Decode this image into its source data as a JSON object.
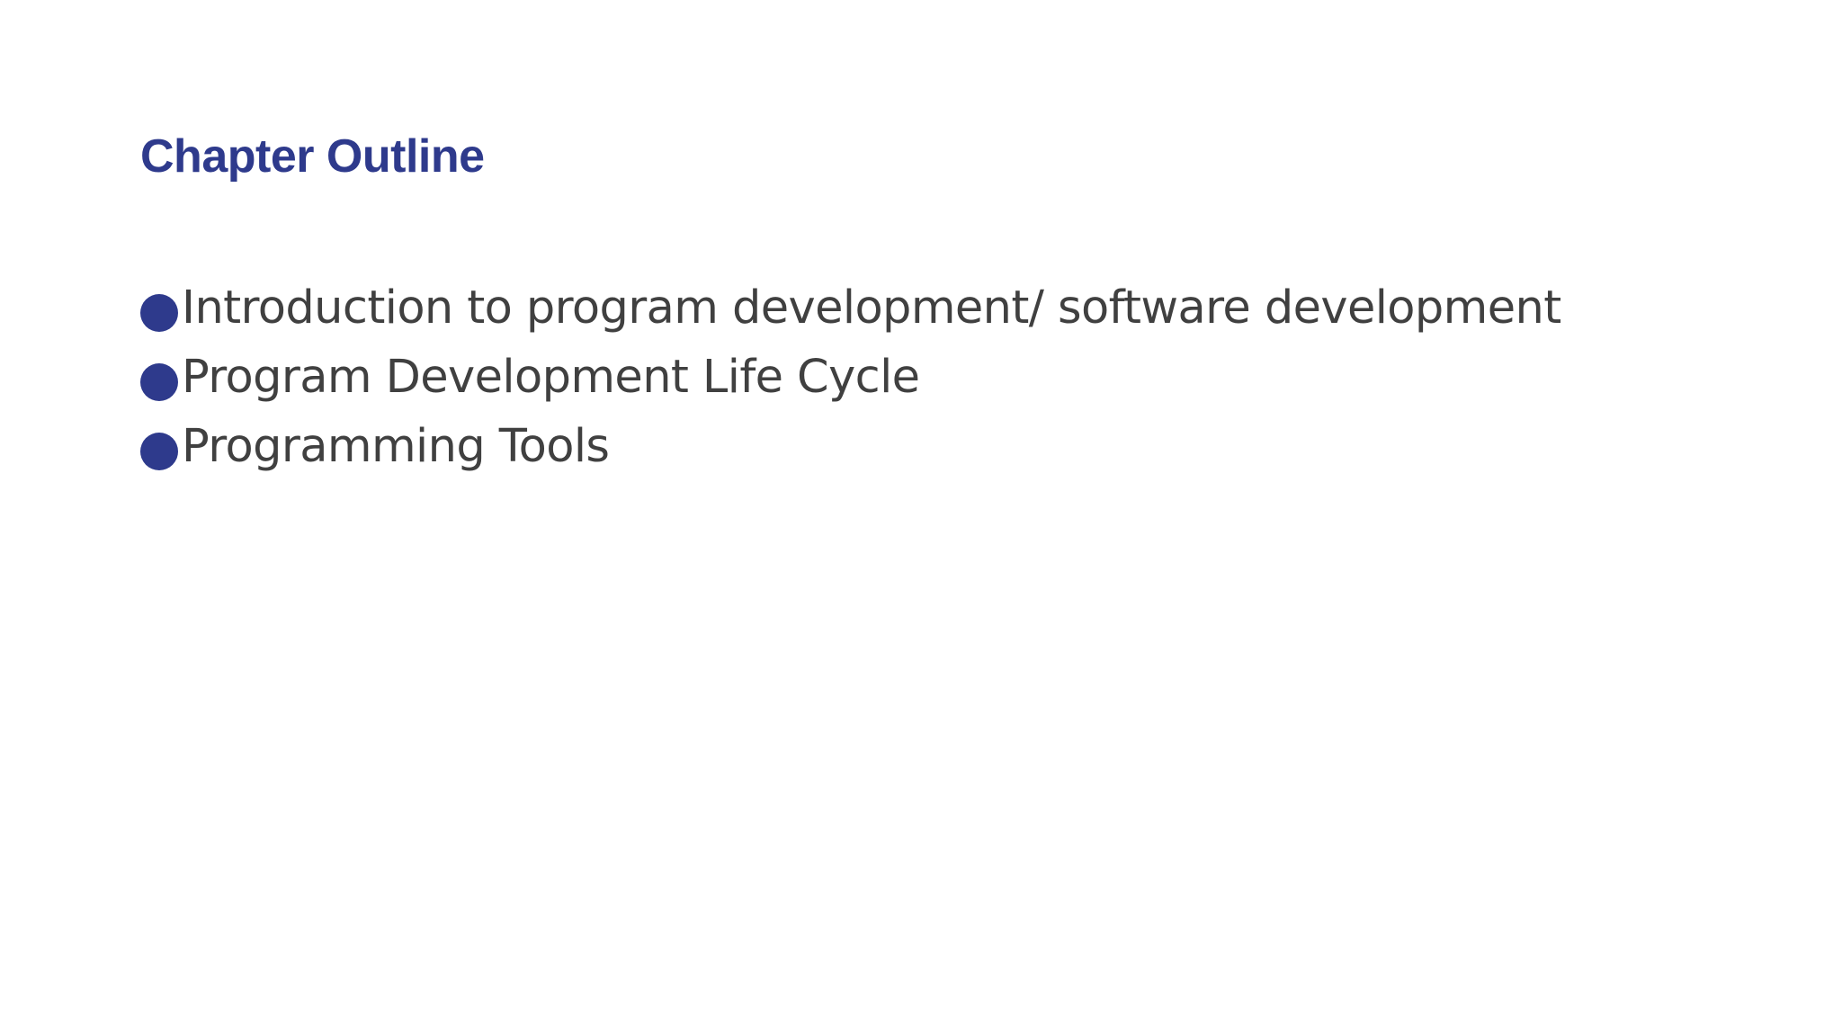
{
  "slide": {
    "title": "Chapter Outline",
    "bullets": [
      {
        "text": "Introduction to program development/ software development"
      },
      {
        "text": "Program Development Life Cycle"
      },
      {
        "text": "Programming Tools"
      }
    ]
  },
  "colors": {
    "title": "#2e3a8c",
    "bullet": "#2e3a8c",
    "body_text": "#404040",
    "background": "#ffffff"
  },
  "icons": {
    "bullet": "filled-circle"
  }
}
